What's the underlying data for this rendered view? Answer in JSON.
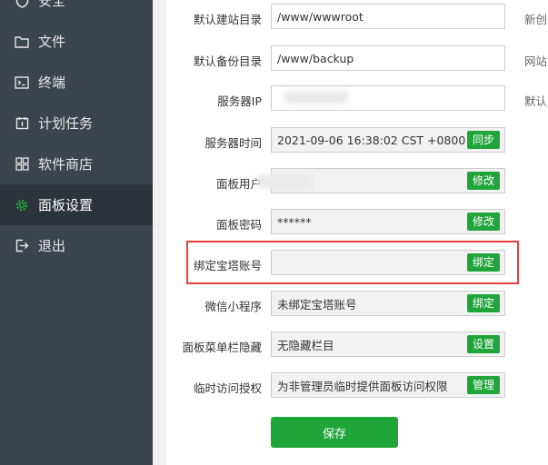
{
  "sidebar": {
    "items": [
      {
        "label": "安全",
        "icon": "shield-icon"
      },
      {
        "label": "文件",
        "icon": "folder-icon"
      },
      {
        "label": "终端",
        "icon": "terminal-icon"
      },
      {
        "label": "计划任务",
        "icon": "calendar-icon"
      },
      {
        "label": "软件商店",
        "icon": "apps-grid-icon"
      },
      {
        "label": "面板设置",
        "icon": "gear-icon"
      },
      {
        "label": "退出",
        "icon": "logout-icon"
      }
    ],
    "active_index": 5
  },
  "settings": {
    "site_dir": {
      "label": "默认建站目录",
      "value": "/www/wwwroot",
      "note": "新创"
    },
    "backup_dir": {
      "label": "默认备份目录",
      "value": "/www/backup",
      "note": "网站"
    },
    "server_ip": {
      "label": "服务器IP",
      "value": "",
      "note": "默认"
    },
    "server_time": {
      "label": "服务器时间",
      "value": "2021-09-06 16:38:02 CST +0800",
      "button": "同步"
    },
    "panel_user": {
      "label": "面板用户",
      "value": "",
      "button": "修改"
    },
    "panel_password": {
      "label": "面板密码",
      "value": "******",
      "button": "修改"
    },
    "bind_account": {
      "label": "绑定宝塔账号",
      "value": "",
      "button": "绑定"
    },
    "wechat_mini": {
      "label": "微信小程序",
      "value": "未绑定宝塔账号",
      "button": "绑定"
    },
    "menu_hide": {
      "label": "面板菜单栏隐藏",
      "value": "无隐藏栏目",
      "button": "设置"
    },
    "temp_access": {
      "label": "临时访问授权",
      "value": "为非管理员临时提供面板访问权限",
      "button": "管理"
    }
  },
  "save_label": "保存",
  "colors": {
    "accent": "#20a53a",
    "sidebar_bg": "#3c444d",
    "highlight": "#e8413a"
  }
}
